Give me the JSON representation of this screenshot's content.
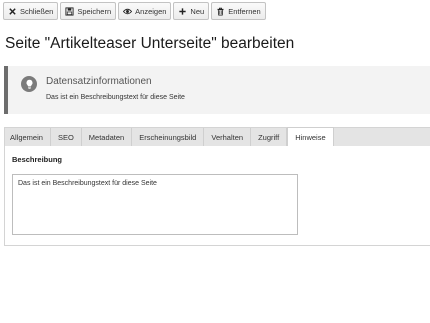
{
  "toolbar": {
    "close_label": "Schließen",
    "save_label": "Speichern",
    "view_label": "Anzeigen",
    "new_label": "Neu",
    "delete_label": "Entfernen"
  },
  "page": {
    "title": "Seite \"Artikelteaser Unterseite\" bearbeiten"
  },
  "infobox": {
    "title": "Datensatzinformationen",
    "text": "Das ist ein Beschreibungstext für diese Seite",
    "icon": "lightbulb-icon"
  },
  "tabs": [
    {
      "label": "Allgemein",
      "active": false
    },
    {
      "label": "SEO",
      "active": false
    },
    {
      "label": "Metadaten",
      "active": false
    },
    {
      "label": "Erscheinungsbild",
      "active": false
    },
    {
      "label": "Verhalten",
      "active": false
    },
    {
      "label": "Zugriff",
      "active": false
    },
    {
      "label": "Hinweise",
      "active": true
    }
  ],
  "form": {
    "description_label": "Beschreibung",
    "description_value": "Das ist ein Beschreibungstext für diese Seite"
  },
  "colors": {
    "infobox_border": "#6d6d6d",
    "infobox_background": "#f3f3f3",
    "tabbar_background": "#e4e4e4"
  }
}
